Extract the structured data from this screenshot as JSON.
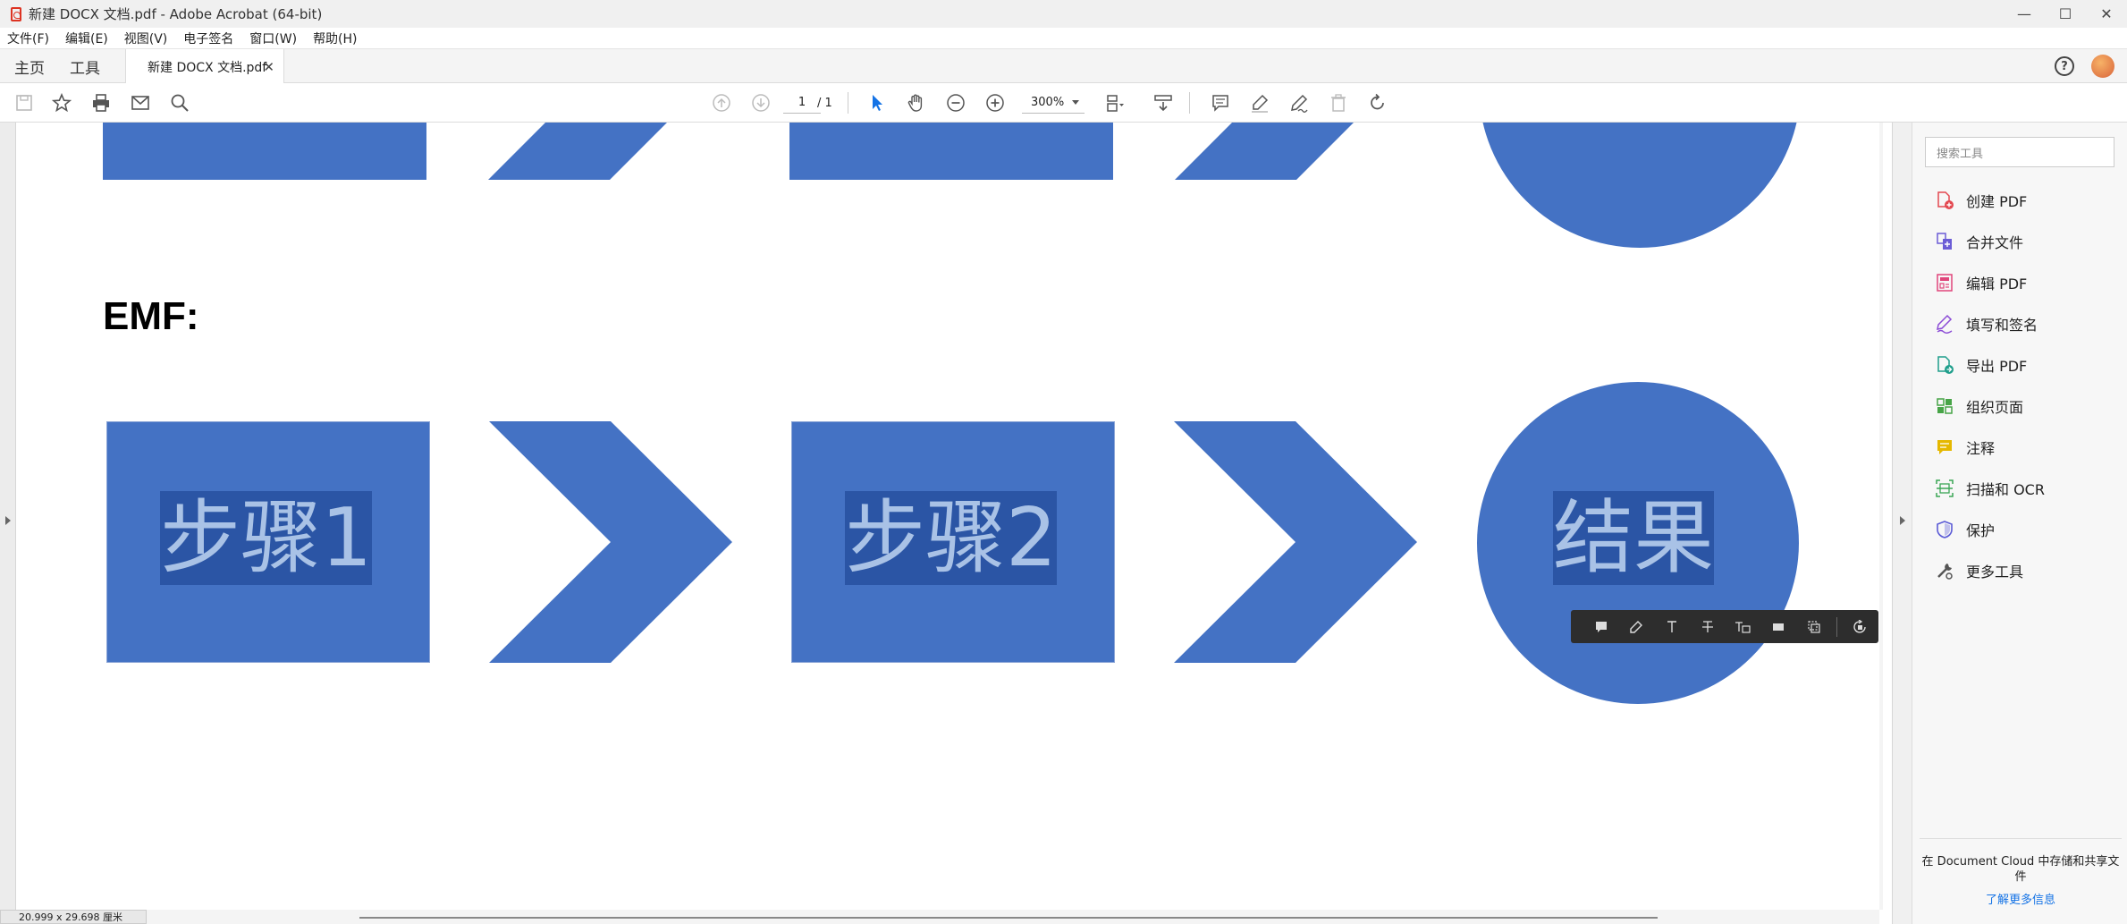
{
  "window": {
    "title": "新建 DOCX 文档.pdf - Adobe Acrobat (64-bit)",
    "minimize": "—",
    "maximize": "☐",
    "close": "✕"
  },
  "menu": [
    "文件(F)",
    "编辑(E)",
    "视图(V)",
    "电子签名",
    "窗口(W)",
    "帮助(H)"
  ],
  "tabs": {
    "home": "主页",
    "tools": "工具",
    "document": "新建 DOCX 文档.pdf",
    "document_close": "✕",
    "help": "?"
  },
  "toolbar": {
    "page_current": "1",
    "page_total": "/ 1",
    "zoom": "300%"
  },
  "document": {
    "emf_label": "EMF:",
    "shapes": [
      {
        "label": "步骤1"
      },
      {
        "label": "步骤2"
      },
      {
        "label": "结果"
      }
    ],
    "page_size": "20.999 x 29.698 厘米"
  },
  "right_pane": {
    "search_placeholder": "搜索工具",
    "tools": [
      {
        "label": "创建 PDF",
        "icon": "create-pdf-icon",
        "color": "#e34850"
      },
      {
        "label": "合并文件",
        "icon": "combine-files-icon",
        "color": "#6b5cd6"
      },
      {
        "label": "编辑 PDF",
        "icon": "edit-pdf-icon",
        "color": "#e0457b"
      },
      {
        "label": "填写和签名",
        "icon": "fill-sign-icon",
        "color": "#8b4bd6"
      },
      {
        "label": "导出 PDF",
        "icon": "export-pdf-icon",
        "color": "#1f9e8b"
      },
      {
        "label": "组织页面",
        "icon": "organize-pages-icon",
        "color": "#47a447"
      },
      {
        "label": "注释",
        "icon": "comment-icon",
        "color": "#e5b800"
      },
      {
        "label": "扫描和 OCR",
        "icon": "scan-ocr-icon",
        "color": "#3aa655"
      },
      {
        "label": "保护",
        "icon": "protect-icon",
        "color": "#5b5bd6"
      },
      {
        "label": "更多工具",
        "icon": "more-tools-icon",
        "color": "#555555"
      }
    ],
    "promo_text": "在 Document Cloud 中存储和共享文件",
    "promo_link": "了解更多信息"
  },
  "colors": {
    "shape_fill": "#4472c4",
    "selection": "#2b55a5",
    "shape_text": "#a9c2e6",
    "link": "#1473e6"
  }
}
